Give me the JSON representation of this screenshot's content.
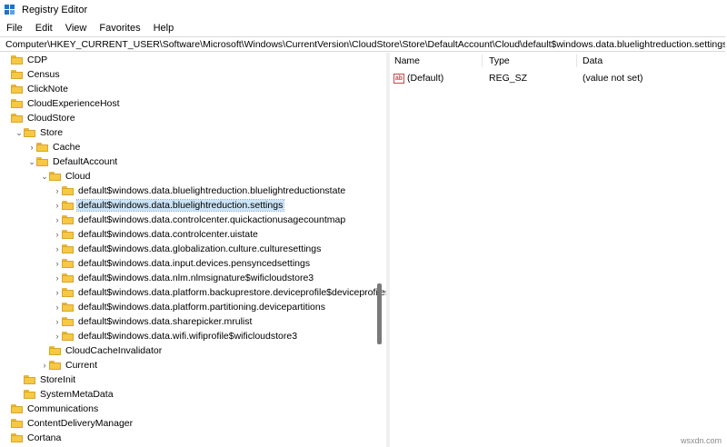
{
  "window": {
    "title": "Registry Editor"
  },
  "menu": [
    "File",
    "Edit",
    "View",
    "Favorites",
    "Help"
  ],
  "address": "Computer\\HKEY_CURRENT_USER\\Software\\Microsoft\\Windows\\CurrentVersion\\CloudStore\\Store\\DefaultAccount\\Cloud\\default$windows.data.bluelightreduction.settings",
  "tree": [
    {
      "label": "CDP",
      "depth": 0,
      "chevron": "",
      "selected": false
    },
    {
      "label": "Census",
      "depth": 0,
      "chevron": "",
      "selected": false
    },
    {
      "label": "ClickNote",
      "depth": 0,
      "chevron": "",
      "selected": false
    },
    {
      "label": "CloudExperienceHost",
      "depth": 0,
      "chevron": "",
      "selected": false
    },
    {
      "label": "CloudStore",
      "depth": 0,
      "chevron": "",
      "selected": false
    },
    {
      "label": "Store",
      "depth": 1,
      "chevron": "⌄",
      "selected": false
    },
    {
      "label": "Cache",
      "depth": 2,
      "chevron": "›",
      "selected": false
    },
    {
      "label": "DefaultAccount",
      "depth": 2,
      "chevron": "⌄",
      "selected": false
    },
    {
      "label": "Cloud",
      "depth": 3,
      "chevron": "⌄",
      "selected": false
    },
    {
      "label": "default$windows.data.bluelightreduction.bluelightreductionstate",
      "depth": 4,
      "chevron": "›",
      "selected": false
    },
    {
      "label": "default$windows.data.bluelightreduction.settings",
      "depth": 4,
      "chevron": "›",
      "selected": true
    },
    {
      "label": "default$windows.data.controlcenter.quickactionusagecountmap",
      "depth": 4,
      "chevron": "›",
      "selected": false
    },
    {
      "label": "default$windows.data.controlcenter.uistate",
      "depth": 4,
      "chevron": "›",
      "selected": false
    },
    {
      "label": "default$windows.data.globalization.culture.culturesettings",
      "depth": 4,
      "chevron": "›",
      "selected": false
    },
    {
      "label": "default$windows.data.input.devices.pensyncedsettings",
      "depth": 4,
      "chevron": "›",
      "selected": false
    },
    {
      "label": "default$windows.data.nlm.nlmsignature$wificloudstore3",
      "depth": 4,
      "chevron": "›",
      "selected": false
    },
    {
      "label": "default$windows.data.platform.backuprestore.deviceprofile$deviceprofiles",
      "depth": 4,
      "chevron": "›",
      "selected": false
    },
    {
      "label": "default$windows.data.platform.partitioning.devicepartitions",
      "depth": 4,
      "chevron": "›",
      "selected": false
    },
    {
      "label": "default$windows.data.sharepicker.mrulist",
      "depth": 4,
      "chevron": "›",
      "selected": false
    },
    {
      "label": "default$windows.data.wifi.wifiprofile$wificloudstore3",
      "depth": 4,
      "chevron": "›",
      "selected": false
    },
    {
      "label": "CloudCacheInvalidator",
      "depth": 3,
      "chevron": "",
      "selected": false
    },
    {
      "label": "Current",
      "depth": 3,
      "chevron": "›",
      "selected": false
    },
    {
      "label": "StoreInit",
      "depth": 1,
      "chevron": "",
      "selected": false
    },
    {
      "label": "SystemMetaData",
      "depth": 1,
      "chevron": "",
      "selected": false
    },
    {
      "label": "Communications",
      "depth": 0,
      "chevron": "",
      "selected": false
    },
    {
      "label": "ContentDeliveryManager",
      "depth": 0,
      "chevron": "",
      "selected": false
    },
    {
      "label": "Cortana",
      "depth": 0,
      "chevron": "",
      "selected": false
    }
  ],
  "columns": {
    "name": "Name",
    "type": "Type",
    "data": "Data"
  },
  "values": [
    {
      "name": "(Default)",
      "type": "REG_SZ",
      "data": "(value not set)"
    }
  ],
  "watermark": "wsxdn.com"
}
